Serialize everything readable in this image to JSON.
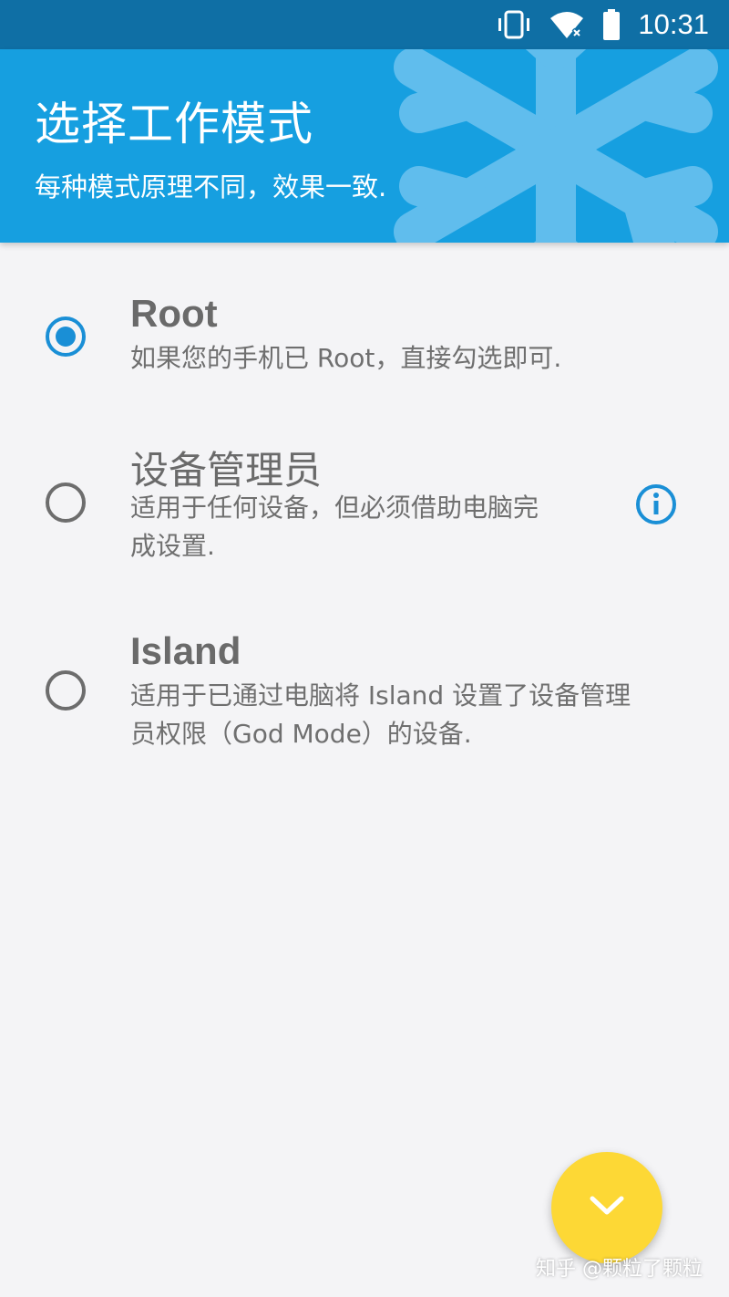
{
  "status_bar": {
    "time": "10:31",
    "icons": [
      "vibrate-icon",
      "wifi-icon",
      "battery-icon"
    ]
  },
  "header": {
    "title": "选择工作模式",
    "subtitle": "每种模式原理不同，效果一致."
  },
  "options": [
    {
      "title": "Root",
      "description_lines": [
        "如果您的手机已 Root，直接勾选即可."
      ],
      "selected": true
    },
    {
      "title": "设备管理员",
      "description_lines": [
        "适用于任何设备，但必须借助电脑完",
        "成设置."
      ],
      "selected": false,
      "has_info_icon": true
    },
    {
      "title": "Island",
      "description_lines": [
        "适用于已通过电脑将 Island 设置了设备管理",
        "员权限（God Mode）的设备."
      ],
      "selected": false
    }
  ],
  "fab": {
    "icon": "chevron-down-icon"
  },
  "watermark": "知乎 @颗粒了颗粒",
  "colors": {
    "status_bar": "#0f6fa5",
    "header": "#169fe0",
    "accent": "#1a8fd6",
    "fab": "#fdd835",
    "background": "#f4f4f6"
  }
}
